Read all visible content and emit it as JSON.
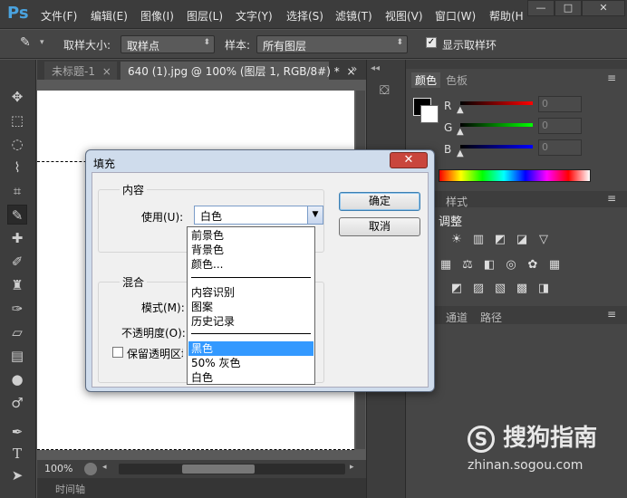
{
  "app": {
    "logo": "Ps"
  },
  "menu": [
    "文件(F)",
    "编辑(E)",
    "图像(I)",
    "图层(L)",
    "文字(Y)",
    "选择(S)",
    "滤镜(T)",
    "视图(V)",
    "窗口(W)",
    "帮助(H"
  ],
  "window_buttons": {
    "minimize": "—",
    "restore": "□",
    "close": "✕"
  },
  "options_bar": {
    "sample_size_label": "取样大小:",
    "sample_size_value": "取样点",
    "sample_label": "样本:",
    "sample_value": "所有图层",
    "show_ring_label": "显示取样环",
    "show_ring_checked": true
  },
  "tabs": [
    {
      "label": "未标题-1",
      "close": "×",
      "active": false
    },
    {
      "label": "640 (1).jpg @ 100% (图层 1, RGB/8#) *",
      "close": "×",
      "active": true
    }
  ],
  "tabs_overflow": "»",
  "status": {
    "zoom": "100%"
  },
  "timeline": {
    "label": "时间轴"
  },
  "color_panel": {
    "tabs": [
      "颜色",
      "色板"
    ],
    "channels": [
      {
        "label": "R",
        "value": "0",
        "color": "#ff0000"
      },
      {
        "label": "G",
        "value": "0",
        "color": "#00ff00"
      },
      {
        "label": "B",
        "value": "0",
        "color": "#0000ff"
      }
    ]
  },
  "adjust_panel": {
    "tabs": [
      "样式"
    ],
    "title": "调整"
  },
  "layers_panel": {
    "tabs": [
      "通道",
      "路径"
    ]
  },
  "dialog": {
    "title": "填充",
    "close": "✕",
    "content_group": "内容",
    "use_label": "使用(U):",
    "use_value": "白色",
    "ok": "确定",
    "cancel": "取消",
    "blend_group": "混合",
    "mode_label": "模式(M):",
    "opacity_label": "不透明度(O):",
    "preserve_label": "保留透明区域"
  },
  "dropdown_options": {
    "group1": [
      "前景色",
      "背景色",
      "颜色..."
    ],
    "group2": [
      "内容识别",
      "图案",
      "历史记录"
    ],
    "group3": [
      "黑色",
      "50% 灰色",
      "白色"
    ],
    "selected": "黑色"
  },
  "watermark": {
    "text": "搜狗指南",
    "url": "zhinan.sogou.com"
  }
}
